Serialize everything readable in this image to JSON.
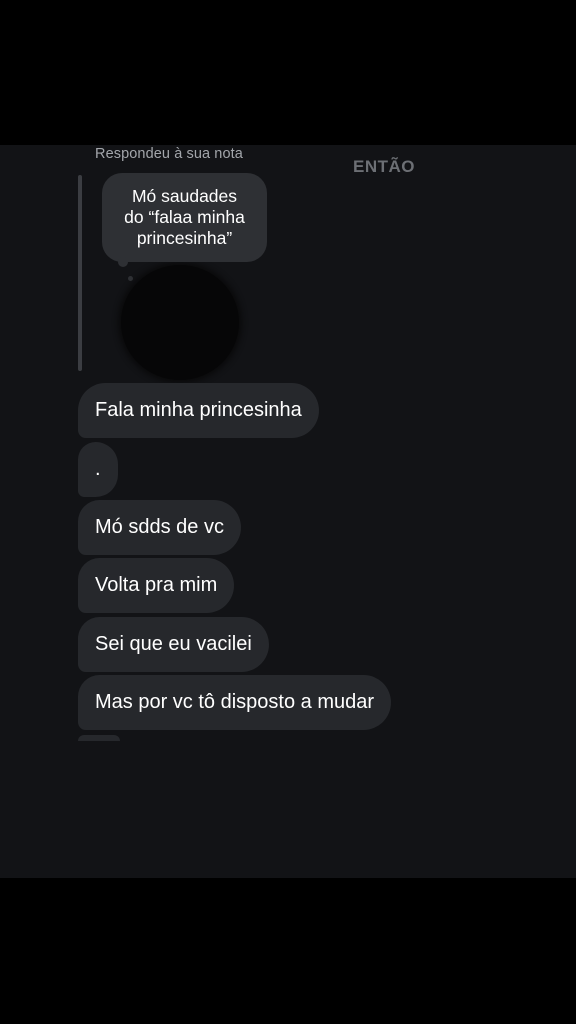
{
  "reply_caption": "Respondeu à sua nota",
  "watermark": "ENTÃO",
  "note_text": "Mó saudades\ndo “falaa minha\nprincesinha”",
  "messages": [
    "Fala minha princesinha",
    ".",
    "Mó sdds de vc",
    "Volta pra mim",
    "Sei que eu vacilei",
    "Mas por vc tô disposto a mudar"
  ],
  "colors": {
    "background": "#121316",
    "bubble": "#26282c",
    "note_bubble": "#2e3034",
    "caption": "#a3a6ab"
  }
}
